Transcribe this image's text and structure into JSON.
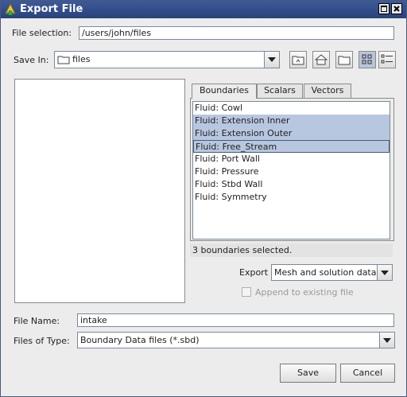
{
  "window": {
    "title": "Export File"
  },
  "file_selection": {
    "label": "File selection:",
    "value": "/users/john/files"
  },
  "save_in": {
    "label": "Save In:",
    "value": "files"
  },
  "tabs": [
    {
      "label": "Boundaries",
      "active": true
    },
    {
      "label": "Scalars",
      "active": false
    },
    {
      "label": "Vectors",
      "active": false
    }
  ],
  "boundaries": [
    {
      "label": "Fluid: Cowl",
      "selected": false
    },
    {
      "label": "Fluid: Extension Inner",
      "selected": true
    },
    {
      "label": "Fluid: Extension Outer",
      "selected": true
    },
    {
      "label": "Fluid: Free_Stream",
      "selected": true
    },
    {
      "label": "Fluid: Port Wall",
      "selected": false
    },
    {
      "label": "Fluid: Pressure",
      "selected": false
    },
    {
      "label": "Fluid: Stbd Wall",
      "selected": false
    },
    {
      "label": "Fluid: Symmetry",
      "selected": false
    }
  ],
  "status": "3 boundaries selected.",
  "export": {
    "label": "Export",
    "value": "Mesh and solution data"
  },
  "append": {
    "label": "Append to existing file",
    "checked": false
  },
  "file_name": {
    "label": "File Name:",
    "value": "intake"
  },
  "files_of_type": {
    "label": "Files of Type:",
    "value": "Boundary Data files (*.sbd)"
  },
  "buttons": {
    "save": "Save",
    "cancel": "Cancel"
  },
  "colors": {
    "titlebar": "#2f4a86",
    "selection": "#b8c7e0"
  }
}
